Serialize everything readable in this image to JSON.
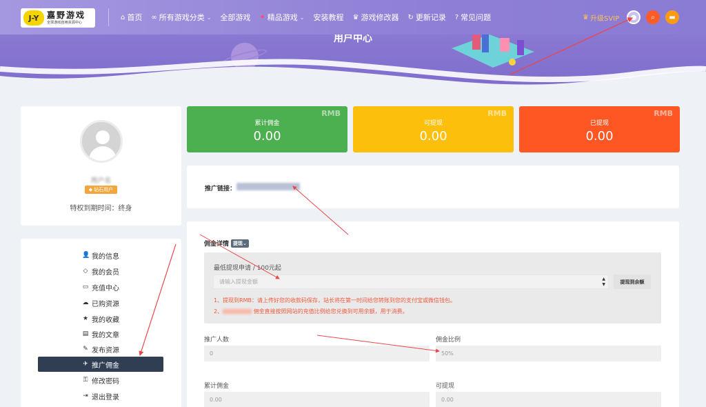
{
  "header": {
    "logo_mark": "J-Y",
    "logo_main": "嘉野游戏",
    "logo_sub": "全球游戏自用资源中心",
    "nav": [
      {
        "icon": "⌂",
        "label": "首页",
        "caret": ""
      },
      {
        "icon": "∞",
        "label": "所有游戏分类",
        "caret": "⌄"
      },
      {
        "icon": "",
        "label": "全部游戏",
        "caret": ""
      },
      {
        "icon": "✦",
        "label": "精品游戏",
        "caret": "⌄"
      },
      {
        "icon": "",
        "label": "安装教程",
        "caret": ""
      },
      {
        "icon": "♛",
        "label": "游戏修改器",
        "caret": ""
      },
      {
        "icon": "↻",
        "label": "更新记录",
        "caret": ""
      },
      {
        "icon": "?",
        "label": "常见问题",
        "caret": ""
      }
    ],
    "vip_label": "升级SVIP",
    "colors": {
      "bar": "#8f7fd6",
      "search": "#ff5b26",
      "menu": "#ff9a12"
    }
  },
  "banner": {
    "title": "用户中心"
  },
  "profile": {
    "username": "用户名",
    "badge": "钻石用户",
    "expire": "特权到期时间：终身"
  },
  "menu": [
    {
      "icon": "👤",
      "label": "我的信息",
      "active": false
    },
    {
      "icon": "◇",
      "label": "我的会员",
      "active": false
    },
    {
      "icon": "▭",
      "label": "充值中心",
      "active": false
    },
    {
      "icon": "☁",
      "label": "已购资源",
      "active": false
    },
    {
      "icon": "★",
      "label": "我的收藏",
      "active": false
    },
    {
      "icon": "▤",
      "label": "我的文章",
      "active": false
    },
    {
      "icon": "✎",
      "label": "发布资源",
      "active": false
    },
    {
      "icon": "✈",
      "label": "推广佣金",
      "active": true
    },
    {
      "icon": "⚿",
      "label": "修改密码",
      "active": false
    },
    {
      "icon": "⇥",
      "label": "退出登录",
      "active": false
    }
  ],
  "stats": [
    {
      "unit": "RMB",
      "label": "累计佣金",
      "value": "0.00",
      "color": "#4cb050"
    },
    {
      "unit": "RMB",
      "label": "可提现",
      "value": "0.00",
      "color": "#fcbf0b"
    },
    {
      "unit": "RMB",
      "label": "已提现",
      "value": "0.00",
      "color": "#ff5724"
    }
  ],
  "promo": {
    "label": "推广链接：",
    "value": ""
  },
  "detail": {
    "title": "佣金详情",
    "tag": "提现⌄",
    "min_label": "最低提现申请 / 100元起",
    "input_placeholder": "请输入提现金额",
    "withdraw_button": "提现到余额",
    "note1": "1、提现到RMB：请上传好您的收款码保存，站长将在第一时间给您转账到您的支付宝或微信钱包。",
    "note2_prefix": "2、",
    "note2_text": "佣金直接按照网站的充值比例给您兑换到可用余额，用于消费。",
    "fields": [
      {
        "label": "推广人数",
        "value": "0"
      },
      {
        "label": "佣金比例",
        "value": "50%"
      },
      {
        "label": "累计佣金",
        "value": "0.00"
      },
      {
        "label": "可提现",
        "value": "0.00"
      }
    ]
  }
}
